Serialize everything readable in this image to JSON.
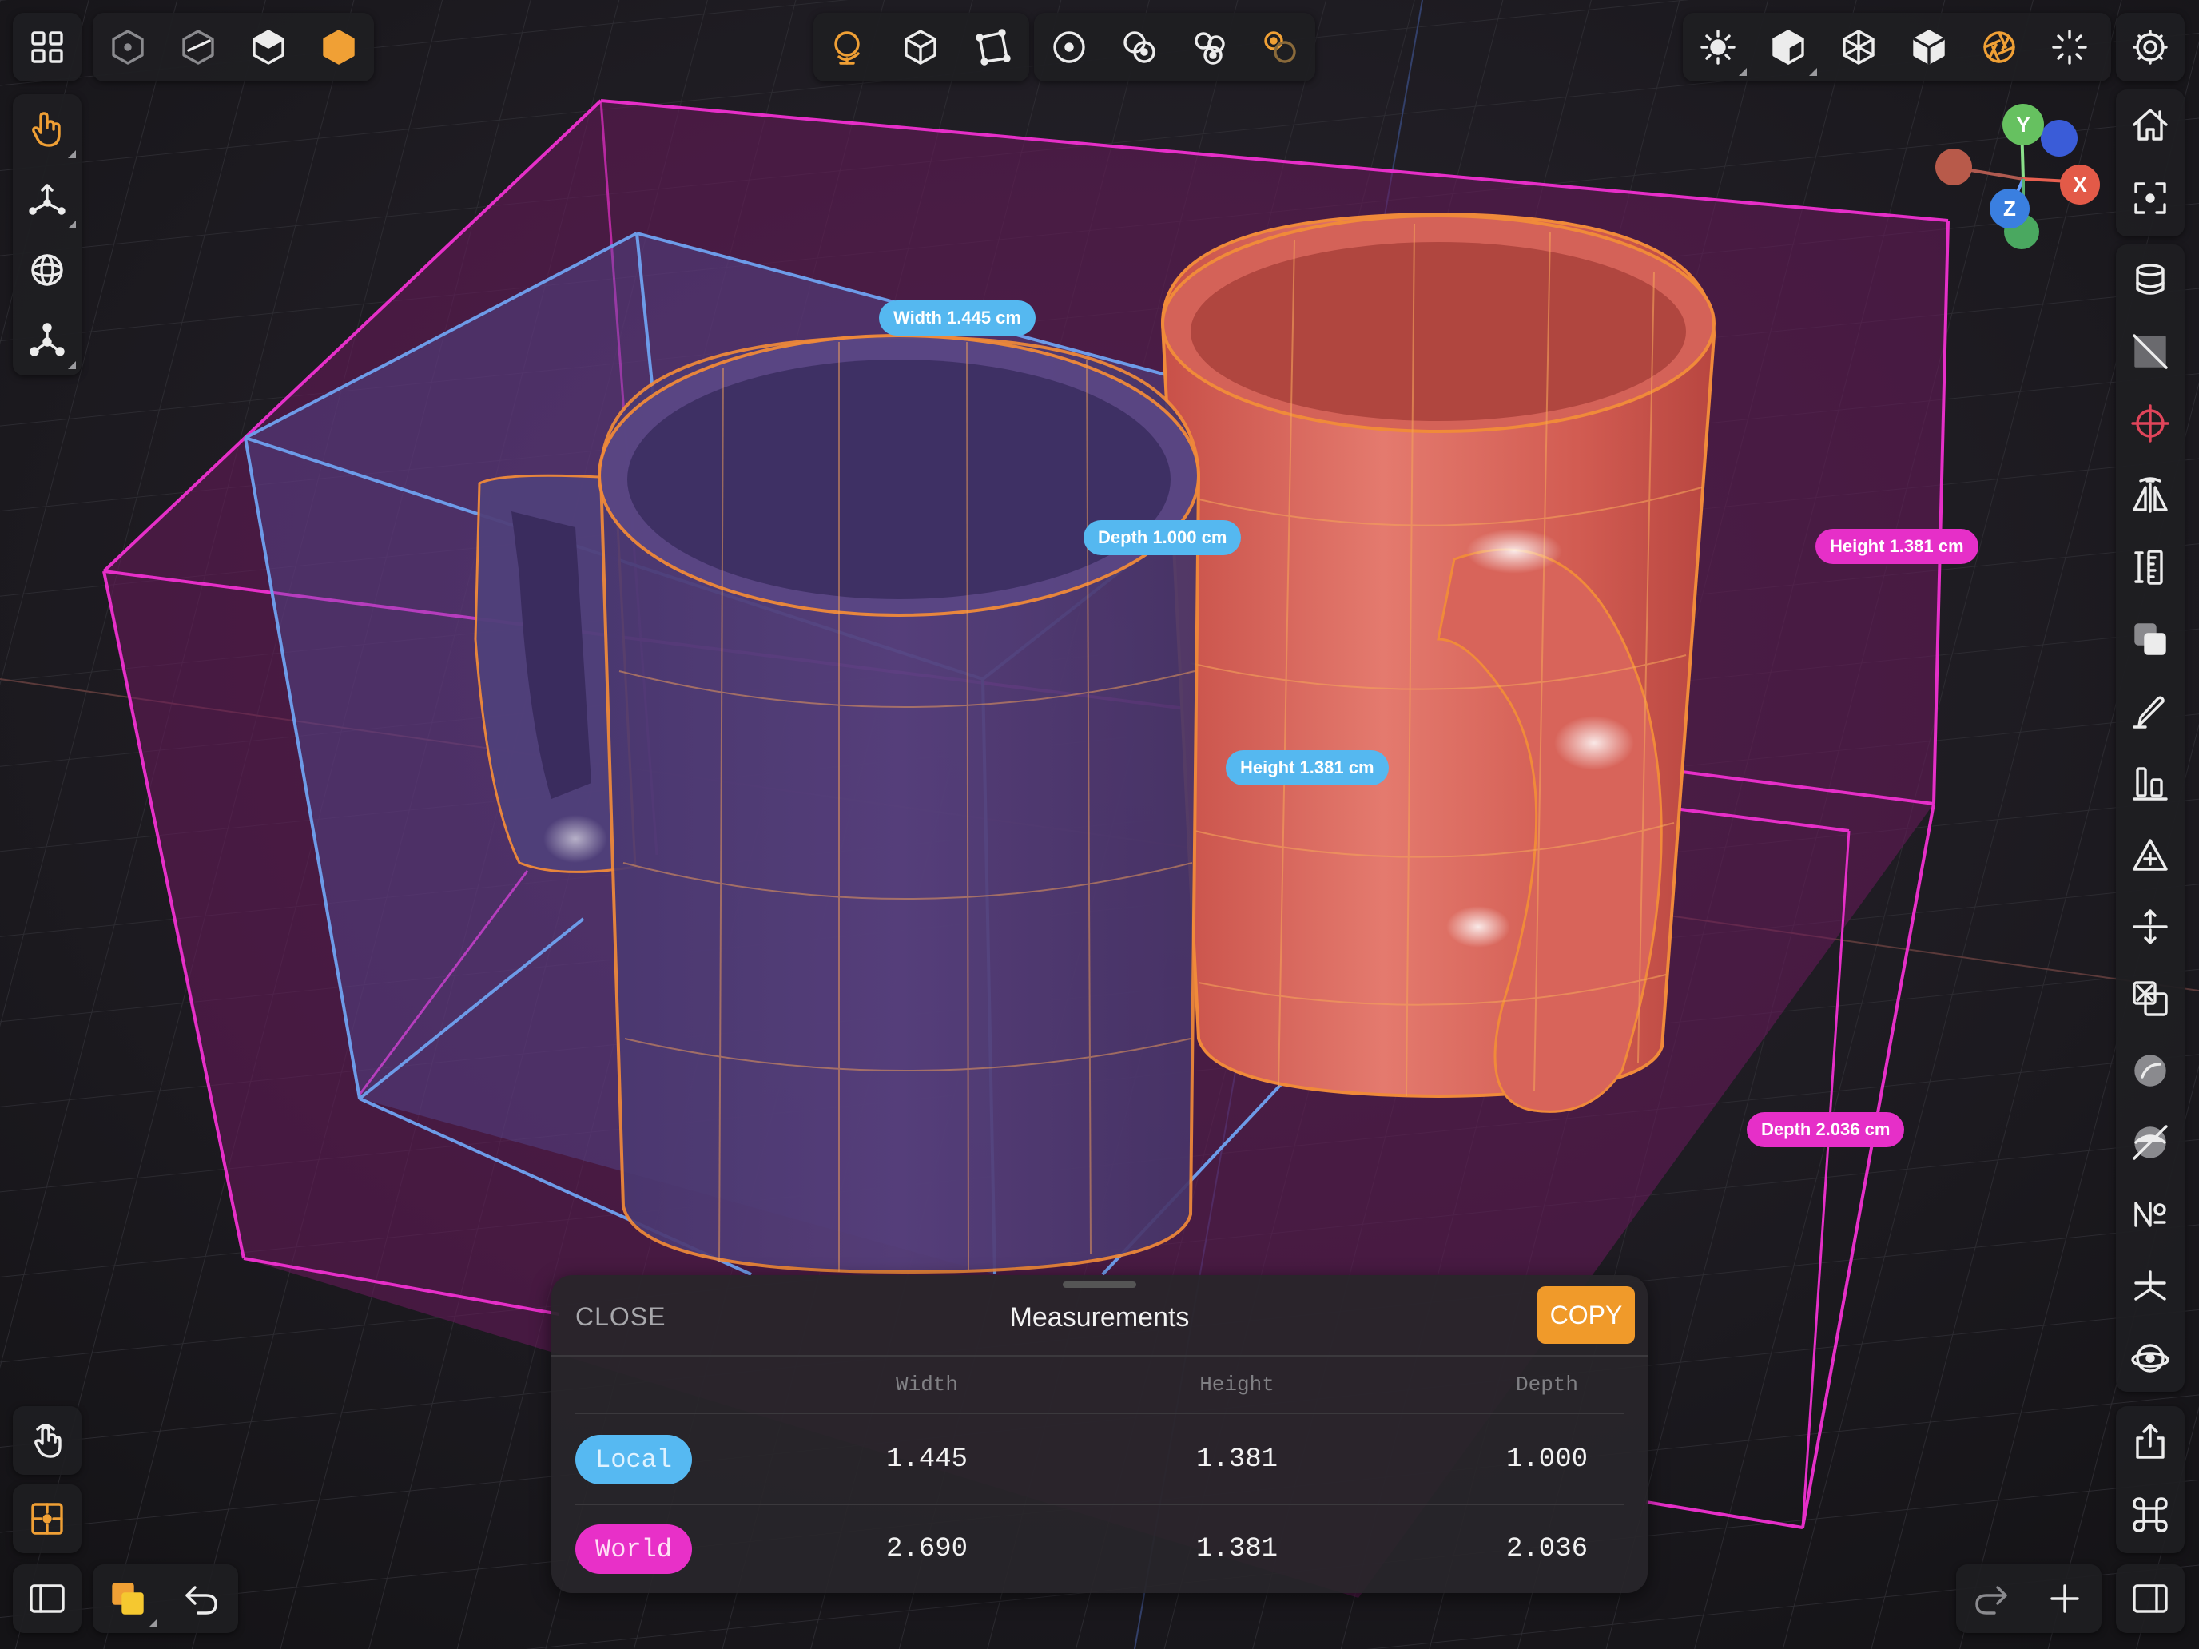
{
  "labels": {
    "blue_width": "Width 1.445 cm",
    "blue_depth": "Depth 1.000 cm",
    "blue_height": "Height 1.381 cm",
    "pink_height": "Height 1.381 cm",
    "pink_depth": "Depth 2.036 cm"
  },
  "gizmo": {
    "y": "Y",
    "x": "X",
    "z": "Z"
  },
  "panel": {
    "close_label": "CLOSE",
    "title": "Measurements",
    "copy_label": "COPY",
    "columns": [
      "Width",
      "Height",
      "Depth"
    ],
    "rows": [
      {
        "name": "Local",
        "values": [
          "1.445",
          "1.381",
          "1.000"
        ]
      },
      {
        "name": "World",
        "values": [
          "2.690",
          "1.381",
          "2.036"
        ]
      }
    ]
  },
  "toolbar_icons": {
    "top_left": [
      "grid-icon",
      "wireframe-cube-icon",
      "half-shaded-cube-icon",
      "solid-cube-icon",
      "hexagon-icon"
    ],
    "top_center": [
      "globe-icon",
      "box-icon",
      "polygon-icon",
      "single-circle-icon",
      "two-circles-icon",
      "three-circles-icon",
      "orange-circles-icon"
    ],
    "top_right": [
      "sun-icon",
      "solid-cube-icon",
      "wire-cube-icon",
      "shaded-cube-icon",
      "aperture-icon",
      "sparkle-icon",
      "settings-gear-icon"
    ],
    "left": [
      "hand-pointer-icon",
      "move-axes-icon",
      "rotate-sphere-icon",
      "pivot-icon"
    ],
    "left_bottom": [
      "touch-icon",
      "snap-target-icon"
    ],
    "bottom_left": [
      "sidebar-icon",
      "layers-icon",
      "undo-icon"
    ],
    "bottom_right": [
      "redo-icon",
      "plus-icon",
      "right-sidebar-icon"
    ],
    "right": [
      "home-icon",
      "focus-icon",
      "cylinder-icon",
      "slice-icon",
      "target-icon",
      "mirror-icon",
      "ruler-icon",
      "duplicate-icon",
      "pen-icon",
      "align-icon",
      "triangle-add-icon",
      "distribute-icon",
      "boolean-icon",
      "sphere-icon",
      "sphere-slash-icon",
      "numero-icon",
      "sparkle-axes-icon",
      "gyroscope-icon",
      "share-icon",
      "command-icon"
    ]
  },
  "colors": {
    "accent_orange": "#f09a2a",
    "local_blue": "#56b9f2",
    "world_pink": "#e830c8",
    "mug_red": "#e06a60"
  }
}
